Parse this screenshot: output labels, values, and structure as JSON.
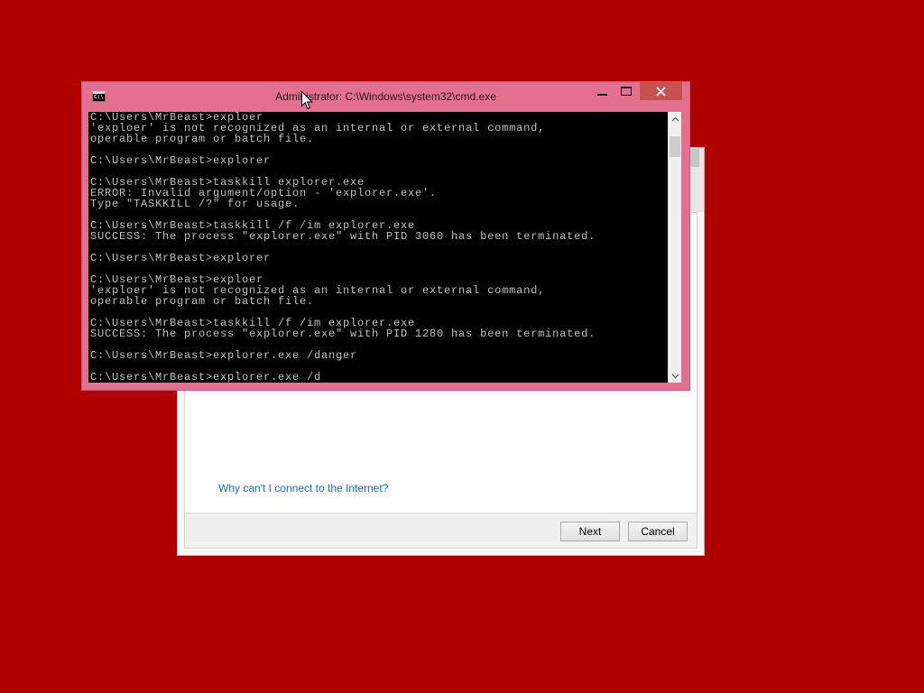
{
  "colors": {
    "desktop_bg": "#b10000",
    "cmd_frame": "#e3708f",
    "cmd_text": "#c0c0c0",
    "close_button": "#c75050",
    "link": "#1e68c0"
  },
  "cmd_window": {
    "title": "Administrator: C:\\Windows\\system32\\cmd.exe",
    "icon": "cmd-icon",
    "icon_label": "C:\\",
    "controls": {
      "minimize": "minimize-icon",
      "maximize": "maximize-icon",
      "close": "close-icon"
    },
    "lines": [
      "C:\\Users\\MrBeast>exploer",
      "'exploer' is not recognized as an internal or external command,",
      "operable program or batch file.",
      "",
      "C:\\Users\\MrBeast>explorer",
      "",
      "C:\\Users\\MrBeast>taskkill explorer.exe",
      "ERROR: Invalid argument/option - 'explorer.exe'.",
      "Type \"TASKKILL /?\" for usage.",
      "",
      "C:\\Users\\MrBeast>taskkill /f /im explorer.exe",
      "SUCCESS: The process \"explorer.exe\" with PID 3060 has been terminated.",
      "",
      "C:\\Users\\MrBeast>explorer",
      "",
      "C:\\Users\\MrBeast>exploer",
      "'exploer' is not recognized as an internal or external command,",
      "operable program or batch file.",
      "",
      "C:\\Users\\MrBeast>taskkill /f /im explorer.exe",
      "SUCCESS: The process \"explorer.exe\" with PID 1280 has been terminated.",
      "",
      "C:\\Users\\MrBeast>explorer.exe /danger",
      "",
      "C:\\Users\\MrBeast>explorer.exe /d"
    ],
    "scrollbar": {
      "position": 0.05,
      "icons": [
        "chevron-up-icon",
        "chevron-down-icon"
      ]
    }
  },
  "wizard_dialog": {
    "help_link": "Why can't I connect to the Internet?",
    "buttons": {
      "next": "Next",
      "cancel": "Cancel"
    },
    "close_icon": "close-icon"
  },
  "cursor": "mouse-pointer-icon"
}
